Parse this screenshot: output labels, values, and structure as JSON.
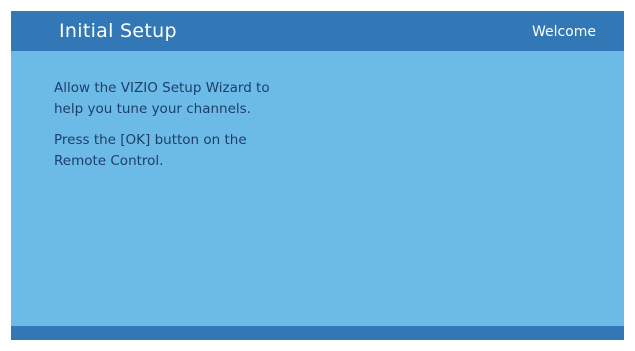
{
  "header": {
    "title": "Initial Setup",
    "subtitle": "Welcome"
  },
  "body": {
    "paragraphs": [
      "Allow the VIZIO Setup Wizard to\nhelp you tune your channels.",
      "Press the [OK] button on the\nRemote Control."
    ]
  },
  "colors": {
    "background": "#6bbbe6",
    "header_bar": "#3278b6",
    "footer_bar": "#3278b6",
    "header_text": "#ffffff",
    "body_text": "#1e3e6a"
  }
}
